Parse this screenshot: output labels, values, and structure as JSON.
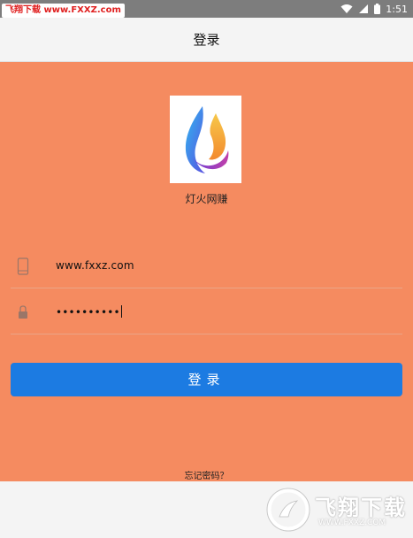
{
  "status_bar": {
    "watermark": "飞翔下载 www.FXXZ.com",
    "time": "1:51",
    "icons": [
      "wifi-icon",
      "signal-icon",
      "battery-icon"
    ]
  },
  "header": {
    "title": "登录"
  },
  "app": {
    "name": "灯火网赚"
  },
  "form": {
    "phone_value": "www.fxxz.com",
    "password_value": "••••••••••",
    "login_label": "登录",
    "forgot_label": "忘记密码？"
  },
  "footer_badge": {
    "text": "飞翔下载",
    "url": "WWW.FXXZ.COM"
  },
  "colors": {
    "background": "#f58b60",
    "button": "#1c7be2",
    "status_bar": "#7d7d7d"
  }
}
